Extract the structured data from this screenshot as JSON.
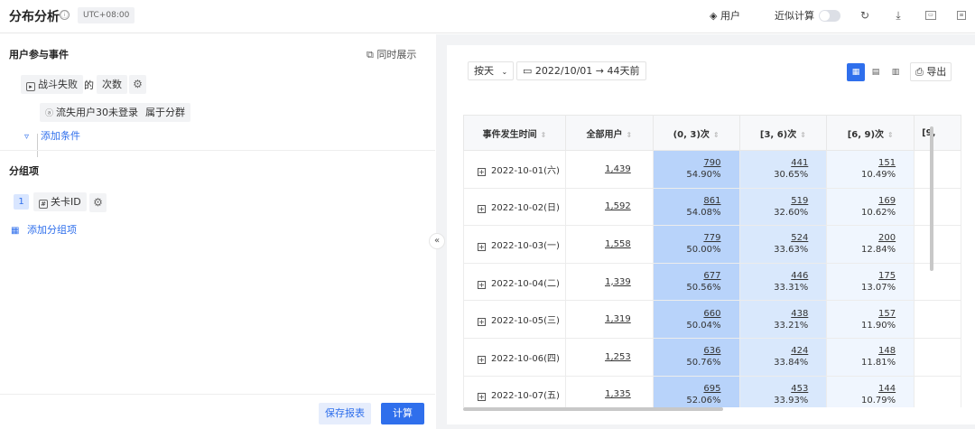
{
  "header": {
    "title": "分布分析",
    "info_icon": "ⓘ",
    "timezone": "UTC+08:00",
    "user_label": "用户",
    "approx_label": "近似计算"
  },
  "left": {
    "event_section_title": "用户参与事件",
    "show_together": "同时展示",
    "event_name": "战斗失败",
    "of_text": "的",
    "metric": "次数",
    "filter_cohort": "流失用户30未登录",
    "filter_op": "属于分群",
    "add_condition": "添加条件",
    "group_section_title": "分组项",
    "group_index": "1",
    "group_field": "关卡ID",
    "add_group": "添加分组项",
    "save_report": "保存报表",
    "calculate": "计算"
  },
  "right": {
    "granularity": "按天",
    "date_range": "2022/10/01 → 44天前",
    "export": "导出",
    "columns": [
      "事件发生时间",
      "全部用户",
      "(0, 3)次",
      "[3, 6)次",
      "[6, 9)次",
      "[9,"
    ],
    "rows": [
      {
        "date": "2022-10-01(六)",
        "total": "1,439",
        "b1n": "790",
        "b1p": "54.90%",
        "b2n": "441",
        "b2p": "30.65%",
        "b3n": "151",
        "b3p": "10.49%"
      },
      {
        "date": "2022-10-02(日)",
        "total": "1,592",
        "b1n": "861",
        "b1p": "54.08%",
        "b2n": "519",
        "b2p": "32.60%",
        "b3n": "169",
        "b3p": "10.62%"
      },
      {
        "date": "2022-10-03(一)",
        "total": "1,558",
        "b1n": "779",
        "b1p": "50.00%",
        "b2n": "524",
        "b2p": "33.63%",
        "b3n": "200",
        "b3p": "12.84%"
      },
      {
        "date": "2022-10-04(二)",
        "total": "1,339",
        "b1n": "677",
        "b1p": "50.56%",
        "b2n": "446",
        "b2p": "33.31%",
        "b3n": "175",
        "b3p": "13.07%"
      },
      {
        "date": "2022-10-05(三)",
        "total": "1,319",
        "b1n": "660",
        "b1p": "50.04%",
        "b2n": "438",
        "b2p": "33.21%",
        "b3n": "157",
        "b3p": "11.90%"
      },
      {
        "date": "2022-10-06(四)",
        "total": "1,253",
        "b1n": "636",
        "b1p": "50.76%",
        "b2n": "424",
        "b2p": "33.84%",
        "b3n": "148",
        "b3p": "11.81%"
      },
      {
        "date": "2022-10-07(五)",
        "total": "1,335",
        "b1n": "695",
        "b1p": "52.06%",
        "b2n": "453",
        "b2p": "33.93%",
        "b3n": "144",
        "b3p": "10.79%"
      }
    ]
  },
  "colors": {
    "accent": "#2f6fec",
    "bucket1_bg": "#b8d3fa",
    "bucket2_bg": "#d9e8fc",
    "bucket3_bg": "#f0f6fe"
  }
}
